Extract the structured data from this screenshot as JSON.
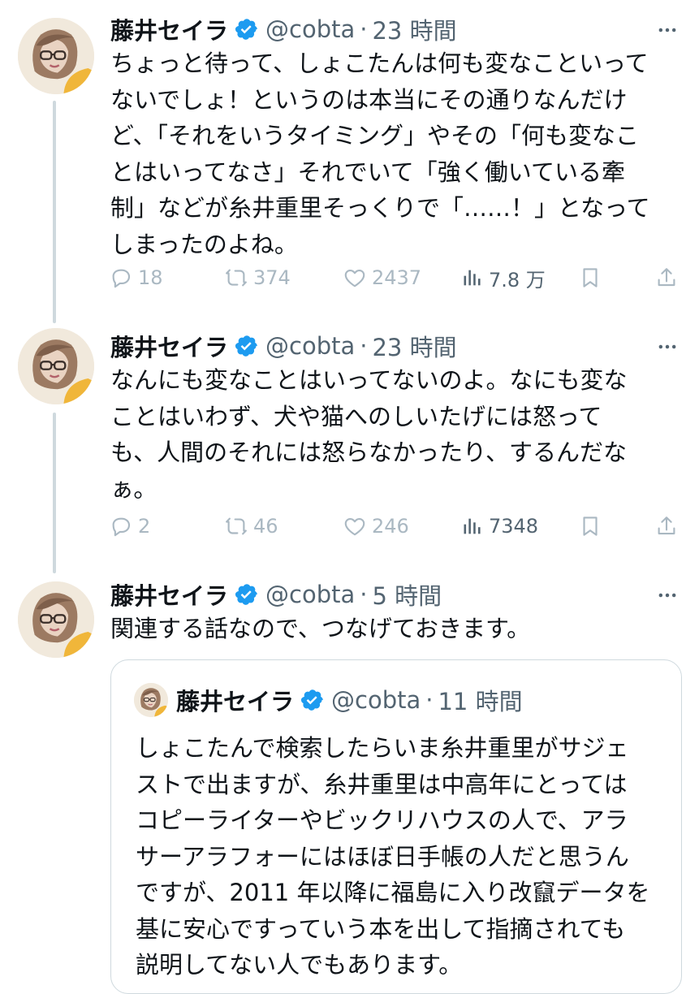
{
  "tweets": [
    {
      "name": "藤井セイラ",
      "handle": "@cobta",
      "separator": "·",
      "time": "23 時間",
      "lines": [
        "ちょっと待って、しょこたんは何も変なこといって",
        "ないでしょ！というのは本当にその通りなんだけ",
        "ど、「それをいうタイミング」やその「何も変なこ",
        "とはいってなさ」それでいて「強く働いている牽",
        "制」などが糸井重里そっくりで「……！」となって",
        "しまったのよね。"
      ],
      "replies": "18",
      "retweets": "374",
      "likes": "2437",
      "views": "7.8 万"
    },
    {
      "name": "藤井セイラ",
      "handle": "@cobta",
      "separator": "·",
      "time": "23 時間",
      "lines": [
        "なんにも変なことはいってないのよ。なにも変な",
        "ことはいわず、犬や猫へのしいたげには怒って",
        "も、人間のそれには怒らなかったり、するんだな",
        "ぁ。"
      ],
      "replies": "2",
      "retweets": "46",
      "likes": "246",
      "views": "7348"
    },
    {
      "name": "藤井セイラ",
      "handle": "@cobta",
      "separator": "·",
      "time": "5 時間",
      "lines": [
        "関連する話なので、つなげておきます。"
      ]
    }
  ],
  "quote": {
    "name": "藤井セイラ",
    "handle": "@cobta",
    "separator": "·",
    "time": "11 時間",
    "lines": [
      "しょこたんで検索したらいま糸井重里がサジェ",
      "ストで出ますが、糸井重里は中高年にとっては",
      "コピーライターやビックリハウスの人で、アラ",
      "サーアラフォーにはほぼ日手帳の人だと思うん",
      "ですが、2011 年以降に福島に入り改竄データを",
      "基に安心ですっていう本を出して指摘されても",
      "説明してない人でもあります。"
    ]
  },
  "colors": {
    "text": "#0f1419",
    "muted": "#536471",
    "faded_icon": "#aab8c2",
    "verified": "#1d9bf0",
    "thread_line": "#cfd9de"
  },
  "icons": [
    "avatar",
    "verified-badge-icon",
    "more-icon",
    "reply-icon",
    "retweet-icon",
    "like-icon",
    "views-icon",
    "bookmark-icon",
    "share-icon"
  ]
}
